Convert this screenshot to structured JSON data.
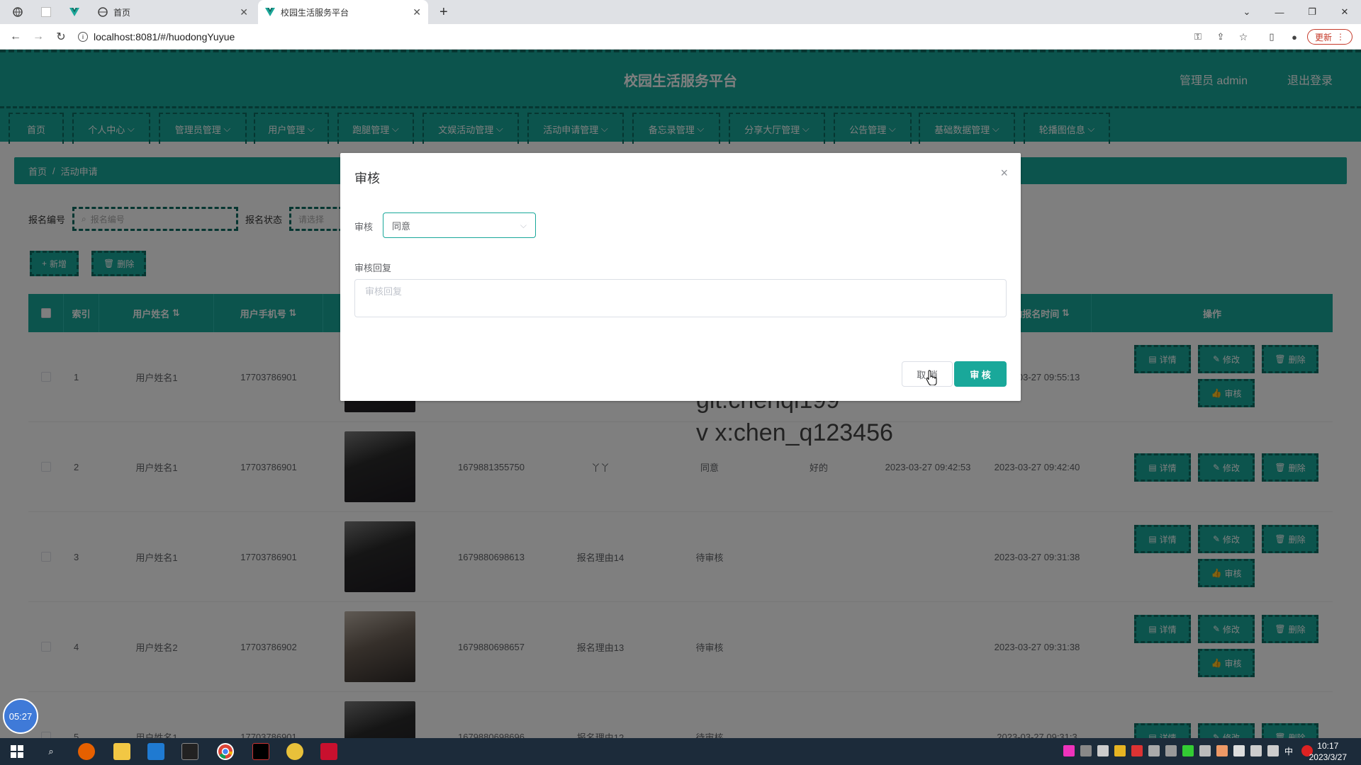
{
  "browser": {
    "tabs": [
      {
        "label": ""
      },
      {
        "label": ""
      },
      {
        "label": ""
      },
      {
        "label": "首页"
      },
      {
        "label": "校园生活服务平台"
      }
    ],
    "new_tab": "+",
    "url": "localhost:8081/#/huodongYuyue",
    "update_label": "更新"
  },
  "app": {
    "title": "校园生活服务平台",
    "user": "管理员 admin",
    "logout": "退出登录",
    "menu": [
      "首页",
      "个人中心",
      "管理员管理",
      "用户管理",
      "跑腿管理",
      "文娱活动管理",
      "活动申请管理",
      "备忘录管理",
      "分享大厅管理",
      "公告管理",
      "基础数据管理",
      "轮播图信息"
    ],
    "breadcrumb": {
      "home": "首页",
      "sep": "/",
      "current": "活动申请"
    },
    "search": {
      "label1": "报名编号",
      "placeholder1": "报名编号",
      "label2": "报名状态",
      "placeholder2": "请选择"
    },
    "buttons": {
      "add": "新增",
      "delete": "删除"
    },
    "table": {
      "headers": [
        "索引",
        "用户姓名",
        "用户手机号",
        "",
        "",
        "",
        "",
        "",
        "活动报名时间",
        "操作"
      ],
      "rows": [
        {
          "index": "1",
          "name": "用户姓名1",
          "phone": "17703786901",
          "number": "",
          "reason": "",
          "status": "",
          "reply": "",
          "reply_time": "",
          "apply_time": "2023-03-27 09:55:13",
          "show_review": true
        },
        {
          "index": "2",
          "name": "用户姓名1",
          "phone": "17703786901",
          "number": "1679881355750",
          "reason": "丫丫",
          "status": "同意",
          "reply": "好的",
          "reply_time": "2023-03-27 09:42:53",
          "apply_time": "2023-03-27 09:42:40",
          "show_review": false
        },
        {
          "index": "3",
          "name": "用户姓名1",
          "phone": "17703786901",
          "number": "1679880698613",
          "reason": "报名理由14",
          "status": "待审核",
          "reply": "",
          "reply_time": "",
          "apply_time": "2023-03-27 09:31:38",
          "show_review": true
        },
        {
          "index": "4",
          "name": "用户姓名2",
          "phone": "17703786902",
          "number": "1679880698657",
          "reason": "报名理由13",
          "status": "待审核",
          "reply": "",
          "reply_time": "",
          "apply_time": "2023-03-27 09:31:38",
          "show_review": true
        },
        {
          "index": "5",
          "name": "用户姓名1",
          "phone": "17703786901",
          "number": "1679880698696",
          "reason": "报名理由12",
          "status": "待审核",
          "reply": "",
          "reply_time": "",
          "apply_time": "2023-03-27 09:31:3",
          "show_review": false
        }
      ],
      "actions": {
        "detail": "详情",
        "edit": "修改",
        "delete": "删除",
        "review": "审核"
      }
    }
  },
  "dialog": {
    "title": "审核",
    "close": "×",
    "review_label": "审核",
    "review_value": "同意",
    "reply_label": "审核回复",
    "reply_placeholder": "审核回复",
    "cancel": "取 消",
    "confirm": "审 核"
  },
  "watermark": {
    "line1": "git:chenqi199",
    "line2": "v x:chen_q123456"
  },
  "timer": "05:27",
  "taskbar": {
    "time": "10:17",
    "date": "2023/3/27",
    "ime": "中"
  },
  "colors": {
    "accent": "#19a89a",
    "accent_dark": "#0c6c62"
  }
}
